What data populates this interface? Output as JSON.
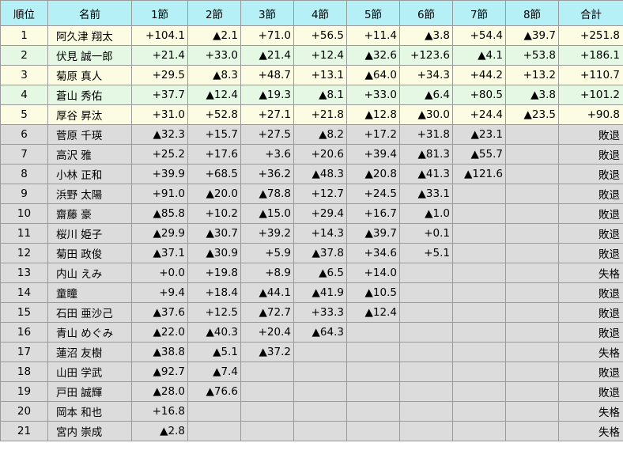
{
  "headers": [
    "順位",
    "名前",
    "1節",
    "2節",
    "3節",
    "4節",
    "5節",
    "6節",
    "7節",
    "8節",
    "合計"
  ],
  "rows": [
    {
      "rank": "1",
      "name": "阿久津 翔太",
      "scores": [
        "+104.1",
        "▲2.1",
        "+71.0",
        "+56.5",
        "+11.4",
        "▲3.8",
        "+54.4",
        "▲39.7"
      ],
      "total": "+251.8"
    },
    {
      "rank": "2",
      "name": "伏見 誠一郎",
      "scores": [
        "+21.4",
        "+33.0",
        "▲21.4",
        "+12.4",
        "▲32.6",
        "+123.6",
        "▲4.1",
        "+53.8"
      ],
      "total": "+186.1"
    },
    {
      "rank": "3",
      "name": "菊原 真人",
      "scores": [
        "+29.5",
        "▲8.3",
        "+48.7",
        "+13.1",
        "▲64.0",
        "+34.3",
        "+44.2",
        "+13.2"
      ],
      "total": "+110.7"
    },
    {
      "rank": "4",
      "name": "蒼山 秀佑",
      "scores": [
        "+37.7",
        "▲12.4",
        "▲19.3",
        "▲8.1",
        "+33.0",
        "▲6.4",
        "+80.5",
        "▲3.8"
      ],
      "total": "+101.2"
    },
    {
      "rank": "5",
      "name": "厚谷 昇汰",
      "scores": [
        "+31.0",
        "+52.8",
        "+27.1",
        "+21.8",
        "▲12.8",
        "▲30.0",
        "+24.4",
        "▲23.5"
      ],
      "total": "+90.8"
    },
    {
      "rank": "6",
      "name": "菅原 千瑛",
      "scores": [
        "▲32.3",
        "+15.7",
        "+27.5",
        "▲8.2",
        "+17.2",
        "+31.8",
        "▲23.1",
        ""
      ],
      "total": "敗退"
    },
    {
      "rank": "7",
      "name": "高沢 雅",
      "scores": [
        "+25.2",
        "+17.6",
        "+3.6",
        "+20.6",
        "+39.4",
        "▲81.3",
        "▲55.7",
        ""
      ],
      "total": "敗退"
    },
    {
      "rank": "8",
      "name": "小林 正和",
      "scores": [
        "+39.9",
        "+68.5",
        "+36.2",
        "▲48.3",
        "▲20.8",
        "▲41.3",
        "▲121.6",
        ""
      ],
      "total": "敗退"
    },
    {
      "rank": "9",
      "name": "浜野 太陽",
      "scores": [
        "+91.0",
        "▲20.0",
        "▲78.8",
        "+12.7",
        "+24.5",
        "▲33.1",
        "",
        ""
      ],
      "total": "敗退"
    },
    {
      "rank": "10",
      "name": "齋藤 豪",
      "scores": [
        "▲85.8",
        "+10.2",
        "▲15.0",
        "+29.4",
        "+16.7",
        "▲1.0",
        "",
        ""
      ],
      "total": "敗退"
    },
    {
      "rank": "11",
      "name": "桜川 姫子",
      "scores": [
        "▲29.9",
        "▲30.7",
        "+39.2",
        "+14.3",
        "▲39.7",
        "+0.1",
        "",
        ""
      ],
      "total": "敗退"
    },
    {
      "rank": "12",
      "name": "菊田 政俊",
      "scores": [
        "▲37.1",
        "▲30.9",
        "+5.9",
        "▲37.8",
        "+34.6",
        "+5.1",
        "",
        ""
      ],
      "total": "敗退"
    },
    {
      "rank": "13",
      "name": "内山 えみ",
      "scores": [
        "+0.0",
        "+19.8",
        "+8.9",
        "▲6.5",
        "+14.0",
        "",
        "",
        ""
      ],
      "total": "失格"
    },
    {
      "rank": "14",
      "name": "童瞳",
      "scores": [
        "+9.4",
        "+18.4",
        "▲44.1",
        "▲41.9",
        "▲10.5",
        "",
        "",
        ""
      ],
      "total": "敗退"
    },
    {
      "rank": "15",
      "name": "石田 亜沙己",
      "scores": [
        "▲37.6",
        "+12.5",
        "▲72.7",
        "+33.3",
        "▲12.4",
        "",
        "",
        ""
      ],
      "total": "敗退"
    },
    {
      "rank": "16",
      "name": "青山 めぐみ",
      "scores": [
        "▲22.0",
        "▲40.3",
        "+20.4",
        "▲64.3",
        "",
        "",
        "",
        ""
      ],
      "total": "敗退"
    },
    {
      "rank": "17",
      "name": "蓮沼 友樹",
      "scores": [
        "▲38.8",
        "▲5.1",
        "▲37.2",
        "",
        "",
        "",
        "",
        ""
      ],
      "total": "失格"
    },
    {
      "rank": "18",
      "name": "山田 学武",
      "scores": [
        "▲92.7",
        "▲7.4",
        "",
        "",
        "",
        "",
        "",
        ""
      ],
      "total": "敗退"
    },
    {
      "rank": "19",
      "name": "戸田 誠輝",
      "scores": [
        "▲28.0",
        "▲76.6",
        "",
        "",
        "",
        "",
        "",
        ""
      ],
      "total": "敗退"
    },
    {
      "rank": "20",
      "name": "岡本 和也",
      "scores": [
        "+16.8",
        "",
        "",
        "",
        "",
        "",
        "",
        ""
      ],
      "total": "失格"
    },
    {
      "rank": "21",
      "name": "宮内 崇成",
      "scores": [
        "▲2.8",
        "",
        "",
        "",
        "",
        "",
        "",
        ""
      ],
      "total": "失格"
    }
  ]
}
